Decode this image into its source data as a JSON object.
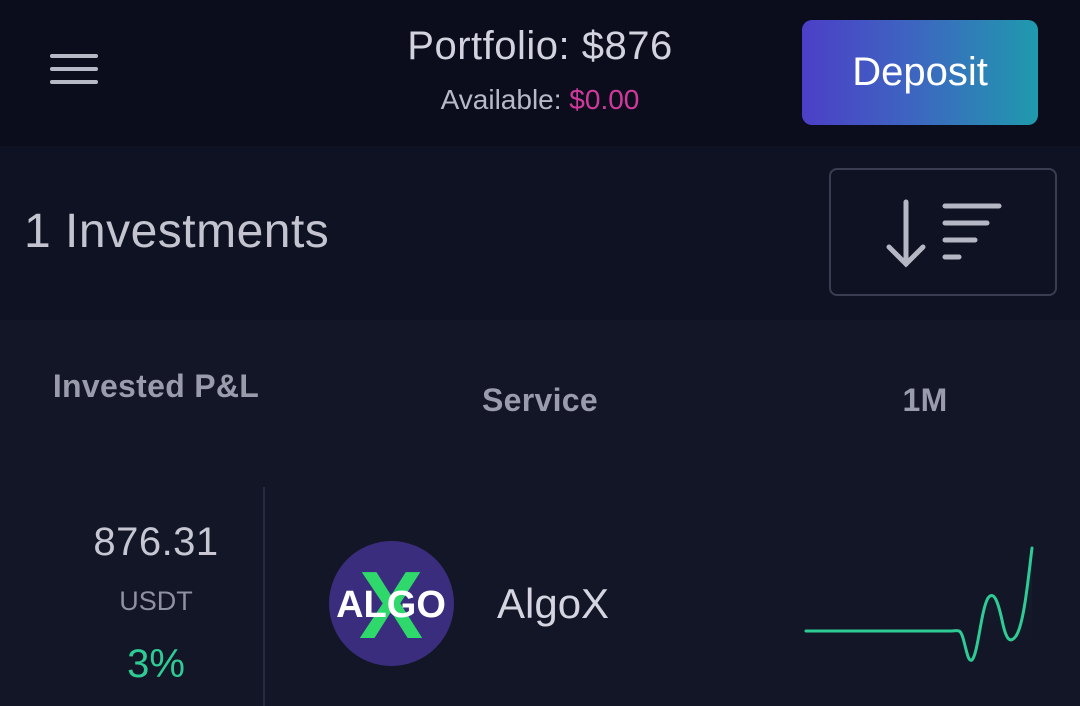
{
  "header": {
    "portfolio_label": "Portfolio:",
    "portfolio_value": "$876",
    "available_label": "Available:",
    "available_value": "$0.00",
    "deposit_label": "Deposit",
    "menu_icon": "hamburger-menu-icon"
  },
  "investments": {
    "count_title": "1 Investments",
    "sort_icon": "sort-descending-icon"
  },
  "table": {
    "columns": [
      "Invested P&L",
      "Service",
      "1M"
    ],
    "rows": [
      {
        "invested": "876.31",
        "currency": "USDT",
        "pnl": "3%",
        "service_name": "AlgoX",
        "logo_text": "ALGO",
        "logo_overlay": "X",
        "trend_color": "#2fcb95"
      }
    ]
  },
  "colors": {
    "accent_pink": "#d0399c",
    "positive_green": "#2fcb95",
    "deposit_gradient_start": "#4c3fc7",
    "deposit_gradient_end": "#1f9aad"
  }
}
